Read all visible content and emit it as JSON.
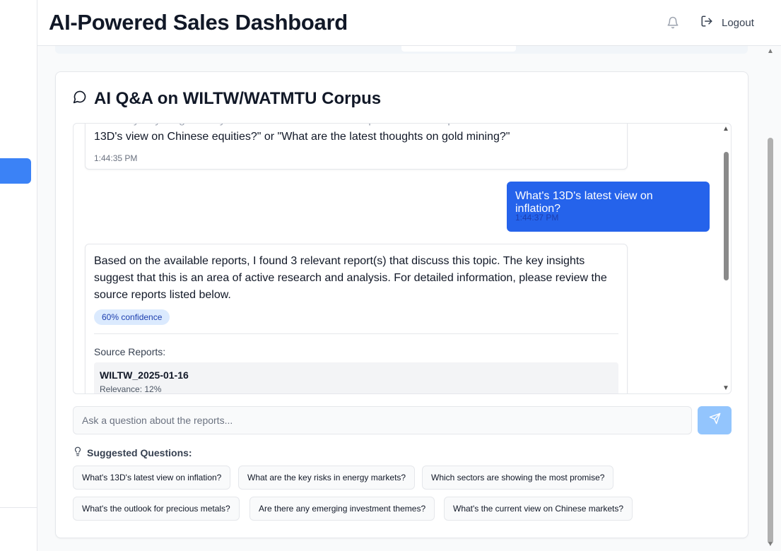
{
  "header": {
    "title": "AI-Powered Sales Dashboard",
    "bell_icon": "bell-icon",
    "logout_icon": "logout-icon",
    "logout_label": "Logout"
  },
  "qa": {
    "title": "AI Q&A on WILTW/WATMTU Corpus",
    "title_icon": "message-circle-icon",
    "messages": [
      {
        "role": "assistant",
        "text_cut": "...ask my anything about your WILTW and WATMTU reports. For example:",
        "text_line2": "13D's view on Chinese equities?\" or \"What are the latest thoughts on gold mining?\"",
        "time": "1:44:35 PM"
      },
      {
        "role": "user",
        "text": "What's 13D's latest view on inflation?",
        "time": "1:44:37 PM"
      },
      {
        "role": "assistant",
        "text": "Based on the available reports, I found 3 relevant report(s) that discuss this topic. The key insights suggest that this is an area of active research and analysis. For detailed information, please review the source reports listed below.",
        "confidence": "60% confidence",
        "sources_title": "Source Reports:",
        "sources": [
          {
            "name": "WILTW_2025-01-16",
            "relevance": "Relevance: 12%"
          }
        ]
      }
    ],
    "input_placeholder": "Ask a question about the reports...",
    "send_icon": "send-icon",
    "suggested_title": "Suggested Questions:",
    "suggested_icon": "lightbulb-icon",
    "suggestions": [
      "What's 13D's latest view on inflation?",
      "What are the key risks in energy markets?",
      "Which sectors are showing the most promise?",
      "What's the outlook for precious metals?",
      "Are there any emerging investment themes?",
      "What's the current view on Chinese markets?"
    ]
  },
  "colors": {
    "primary": "#2563eb",
    "sidebar_active": "#3b82f6",
    "send_disabled": "#93c5fd",
    "badge_bg": "#dbeafe",
    "badge_text": "#1e40af"
  }
}
